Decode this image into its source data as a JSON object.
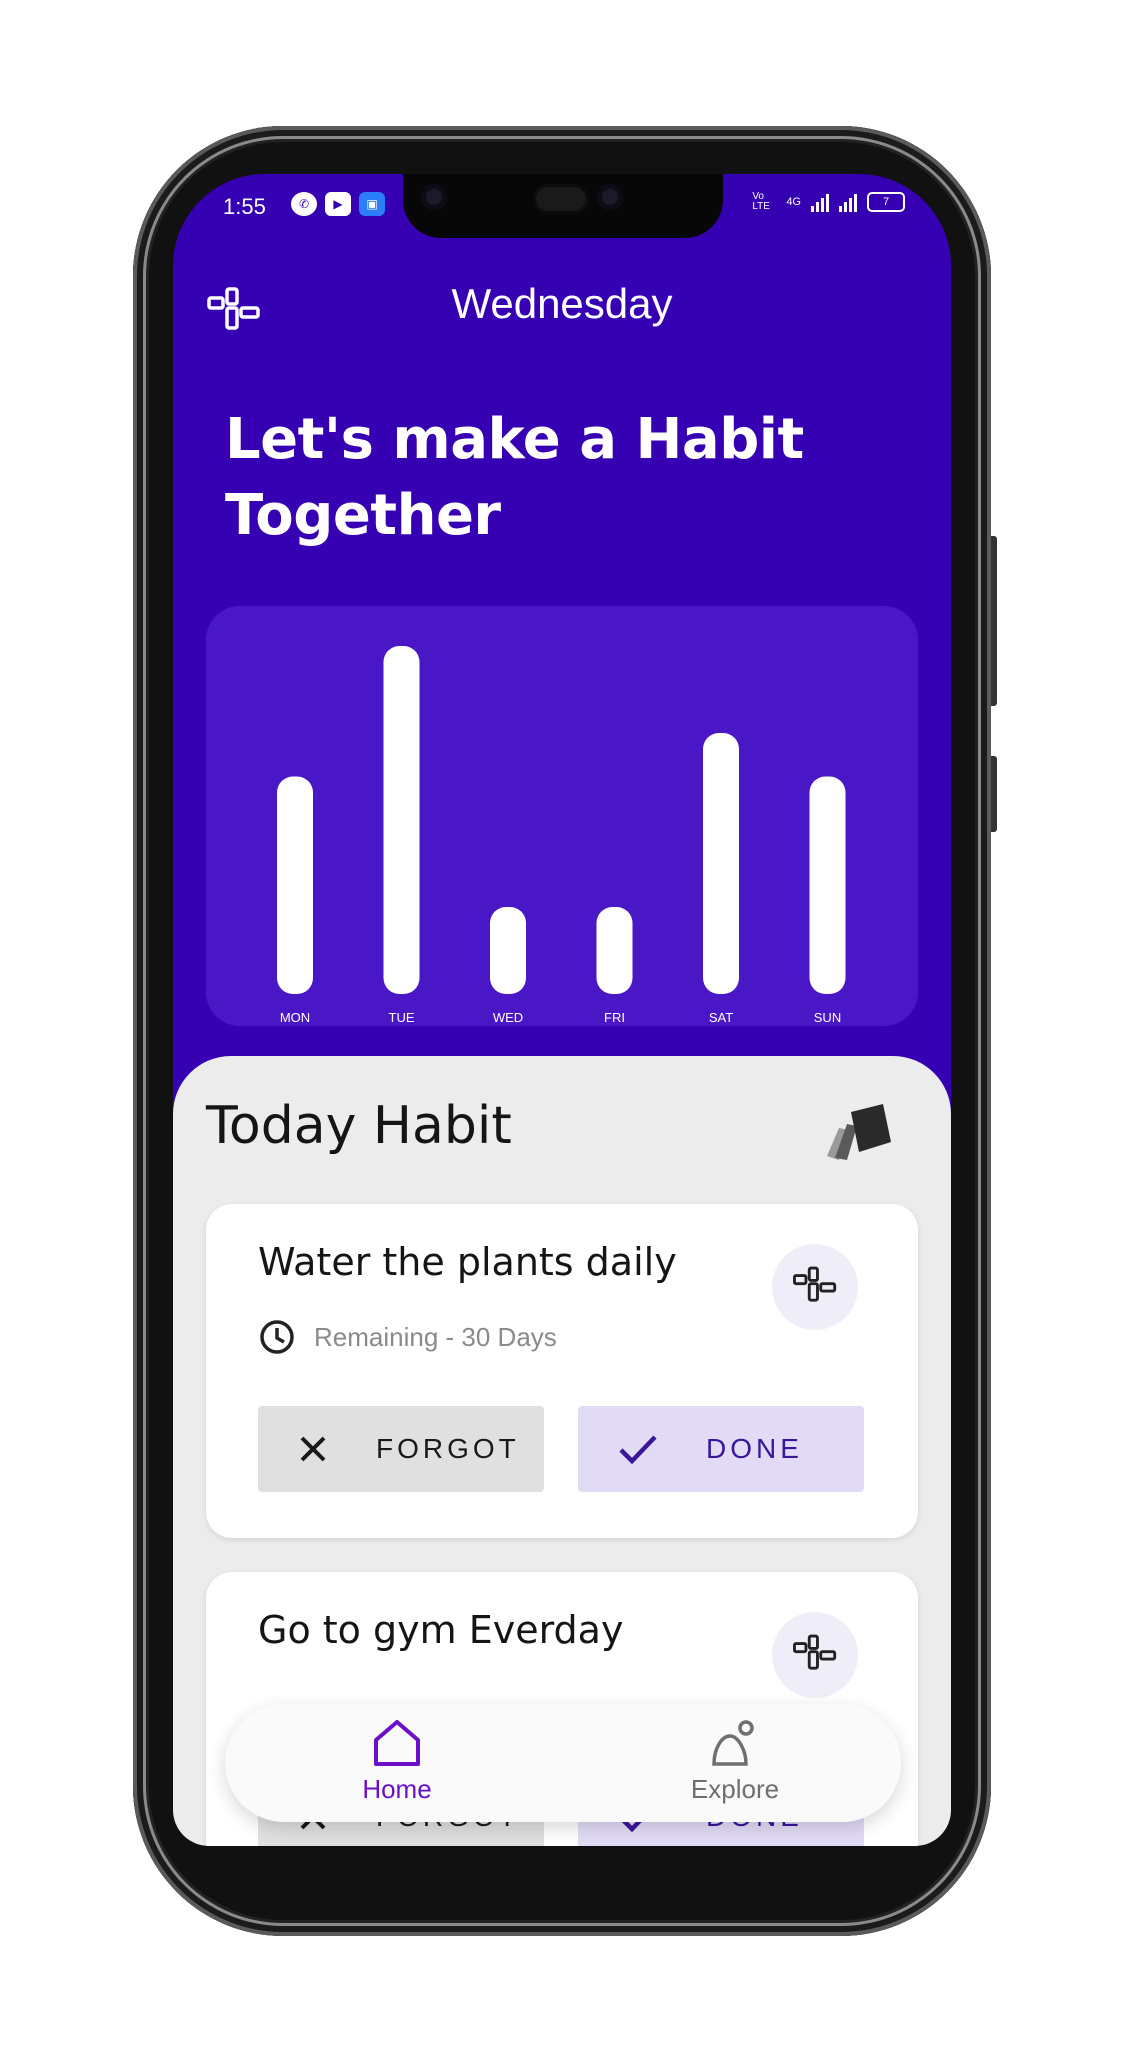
{
  "status_bar": {
    "time": "1:55",
    "volte_label": "Vo LTE",
    "network_label": "4G",
    "battery_level": "7"
  },
  "header": {
    "day": "Wednesday",
    "headline": "Let's make a Habit Together"
  },
  "chart_data": {
    "type": "bar",
    "categories": [
      "MON",
      "TUE",
      "WED",
      "FRI",
      "SAT",
      "SUN"
    ],
    "values": [
      5,
      8,
      2,
      2,
      6,
      5
    ],
    "ylim": [
      0,
      8
    ],
    "title": "",
    "xlabel": "",
    "ylabel": "",
    "grid": false,
    "bar_color": "#ffffff"
  },
  "today": {
    "title": "Today Habit"
  },
  "habits": [
    {
      "name": "Water the plants daily",
      "remaining": "Remaining - 30 Days",
      "forgot_label": "FORGOT",
      "done_label": "DONE"
    },
    {
      "name": "Go to gym Everday",
      "forgot_label": "FORGOT",
      "done_label": "DONE"
    }
  ],
  "nav": {
    "home_label": "Home",
    "explore_label": "Explore"
  },
  "colors": {
    "primary": "#3600b3",
    "card": "#4a17c7",
    "accent": "#6a10c8",
    "done_bg": "#e2dbf6"
  },
  "icons": {
    "menu": "blocks-icon",
    "stack": "stack-icon",
    "clock": "clock-icon",
    "close": "close-icon",
    "check": "check-icon",
    "home": "home-icon",
    "explore": "explore-icon"
  }
}
